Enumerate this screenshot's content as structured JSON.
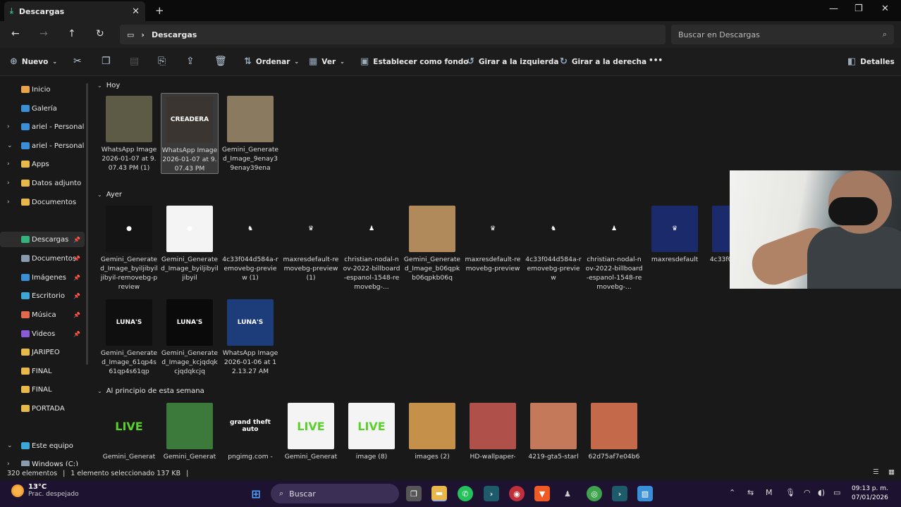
{
  "tab": {
    "title": "Descargas"
  },
  "address": {
    "path": "Descargas",
    "search_placeholder": "Buscar en Descargas"
  },
  "commands": {
    "new": "Nuevo",
    "sort": "Ordenar",
    "view": "Ver",
    "set_background": "Establecer como fondo",
    "rotate_left": "Girar a la izquierda",
    "rotate_right": "Girar a la derecha",
    "more": "•••",
    "details": "Detalles"
  },
  "sidebar": {
    "items": [
      {
        "label": "Inicio",
        "chevron": "",
        "color": "#e8a34b",
        "pin": ""
      },
      {
        "label": "Galería",
        "chevron": "",
        "color": "#3b8fd9",
        "pin": ""
      },
      {
        "label": "ariel - Personal",
        "chevron": "›",
        "color": "#3b8fd9",
        "pin": ""
      },
      {
        "label": "ariel - Personal",
        "chevron": "⌄",
        "color": "#3b8fd9",
        "pin": ""
      },
      {
        "label": "Apps",
        "chevron": "›",
        "color": "#e8b84b",
        "pin": ""
      },
      {
        "label": "Datos adjunto",
        "chevron": "›",
        "color": "#e8b84b",
        "pin": ""
      },
      {
        "label": "Documentos",
        "chevron": "›",
        "color": "#e8b84b",
        "pin": ""
      },
      {
        "label": "Descargas",
        "chevron": "",
        "color": "#35b37e",
        "pin": "📌"
      },
      {
        "label": "Documentos",
        "chevron": "",
        "color": "#8a9bb0",
        "pin": "📌"
      },
      {
        "label": "Imágenes",
        "chevron": "",
        "color": "#3b8fd9",
        "pin": "📌"
      },
      {
        "label": "Escritorio",
        "chevron": "",
        "color": "#3ba8d9",
        "pin": "📌"
      },
      {
        "label": "Música",
        "chevron": "",
        "color": "#e06a4b",
        "pin": "📌"
      },
      {
        "label": "Videos",
        "chevron": "",
        "color": "#8a5bd9",
        "pin": "📌"
      },
      {
        "label": "JARIPEO",
        "chevron": "",
        "color": "#e8b84b",
        "pin": ""
      },
      {
        "label": "FINAL",
        "chevron": "",
        "color": "#e8b84b",
        "pin": ""
      },
      {
        "label": "FINAL",
        "chevron": "",
        "color": "#e8b84b",
        "pin": ""
      },
      {
        "label": "PORTADA",
        "chevron": "",
        "color": "#e8b84b",
        "pin": ""
      },
      {
        "label": "Este equipo",
        "chevron": "⌄",
        "color": "#3ba8d9",
        "pin": ""
      },
      {
        "label": "Windows (C:)",
        "chevron": "›",
        "color": "#8a9bb0",
        "pin": ""
      }
    ]
  },
  "groups": {
    "today": "Hoy",
    "yesterday": "Ayer",
    "this_week": "Al principio de esta semana"
  },
  "files_today": [
    {
      "name": "WhatsApp Image 2026-01-07 at 9.07.43 PM (1)",
      "bg": "#5d5a45",
      "thumb": ""
    },
    {
      "name": "WhatsApp Image 2026-01-07 at 9.07.43 PM",
      "bg": "#3a3530",
      "thumb": "CREADERA"
    },
    {
      "name": "Gemini_Generated_Image_9enay39enay39ena",
      "bg": "#8a7a60",
      "thumb": ""
    }
  ],
  "files_yesterday": [
    {
      "name": "Gemini_Generated_Image_byiljibyiljibyil-removebg-preview",
      "bg": "#141414",
      "thumb": "●"
    },
    {
      "name": "Gemini_Generated_Image_byiljibyiljibyil",
      "bg": "#f4f4f4",
      "thumb": "●"
    },
    {
      "name": "4c33f044d584a-removebg-preview (1)",
      "bg": "#191919",
      "thumb": "♞"
    },
    {
      "name": "maxresdefault-removebg-preview (1)",
      "bg": "#191919",
      "thumb": "♛"
    },
    {
      "name": "christian-nodal-nov-2022-billboard-espanol-1548-removebg-...",
      "bg": "#191919",
      "thumb": "♟"
    },
    {
      "name": "Gemini_Generated_Image_b06qpkb06qpkb06q",
      "bg": "#b08a5a",
      "thumb": ""
    },
    {
      "name": "maxresdefault-removebg-preview",
      "bg": "#191919",
      "thumb": "♛"
    },
    {
      "name": "4c33f044d584a-removebg-preview",
      "bg": "#191919",
      "thumb": "♞"
    },
    {
      "name": "christian-nodal-nov-2022-billboard-espanol-1548-removebg-...",
      "bg": "#191919",
      "thumb": "♟"
    },
    {
      "name": "maxresdefault",
      "bg": "#1a2a6a",
      "thumb": "♛"
    },
    {
      "name": "4c33f044d584a",
      "bg": "#1a2a6a",
      "thumb": ""
    },
    {
      "name": "Gemini_Generated_Image_61qp4s61qp4s61qp",
      "bg": "#0f0f0f",
      "thumb": "LUNA'S"
    },
    {
      "name": "Gemini_Generated_Image_kcjqdqkcjqdqkcjq",
      "bg": "#0a0a0a",
      "thumb": "LUNA'S"
    },
    {
      "name": "WhatsApp Image 2026-01-06 at 12.13.27 AM",
      "bg": "#1d3d7a",
      "thumb": "LUNA'S"
    }
  ],
  "files_week": [
    {
      "name": "Gemini_Generat",
      "bg": "#191919",
      "thumb": "LIVE"
    },
    {
      "name": "Gemini_Generat",
      "bg": "#3b7a3a",
      "thumb": ""
    },
    {
      "name": "pngimg.com -",
      "bg": "#191919",
      "thumb": "grand theft auto"
    },
    {
      "name": "Gemini_Generat",
      "bg": "#f4f4f4",
      "thumb": "LIVE"
    },
    {
      "name": "image (8)",
      "bg": "#f4f4f4",
      "thumb": "LIVE"
    },
    {
      "name": "images (2)",
      "bg": "#c4904a",
      "thumb": ""
    },
    {
      "name": "HD-wallpaper-",
      "bg": "#b0504a",
      "thumb": ""
    },
    {
      "name": "4219-gta5-starl",
      "bg": "#c47a5a",
      "thumb": ""
    },
    {
      "name": "62d75af7e04b6",
      "bg": "#c46a4a",
      "thumb": ""
    }
  ],
  "status": {
    "count": "320 elementos",
    "selection": "1 elemento seleccionado  137 KB"
  },
  "taskbar": {
    "temp": "13°C",
    "weather": "Prac. despejado",
    "search": "Buscar",
    "time": "09:13 p. m.",
    "date": "07/01/2026"
  }
}
